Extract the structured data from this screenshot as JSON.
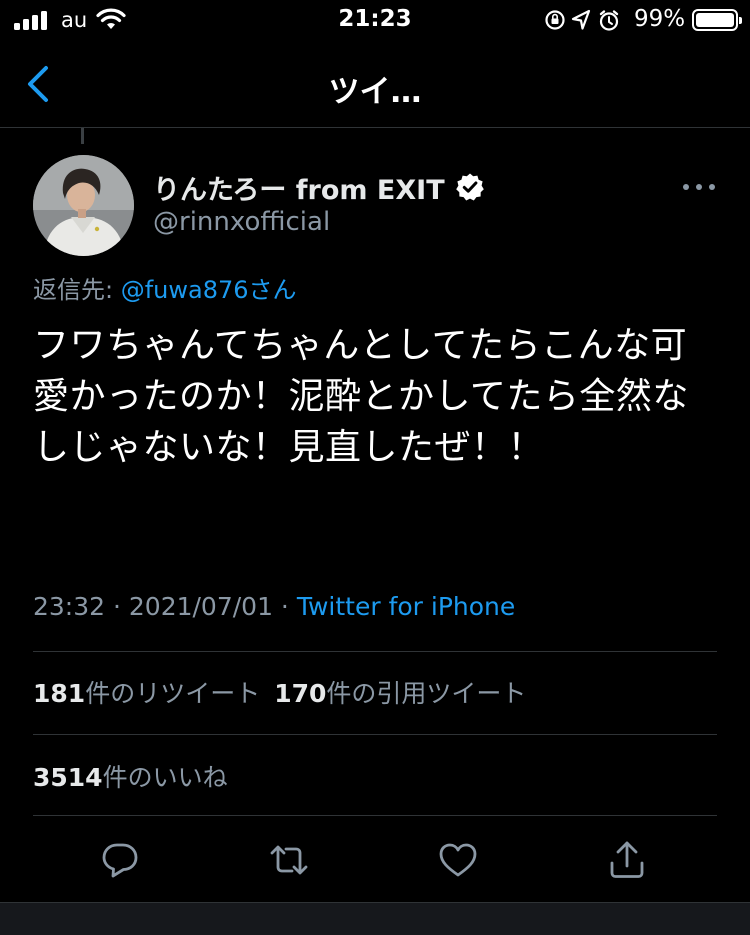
{
  "status_bar": {
    "carrier": "au",
    "time": "21:23",
    "battery_percent": "99%",
    "battery_level": 0.99
  },
  "nav": {
    "title": "ツイ…"
  },
  "tweet": {
    "display_name": "りんたろー from EXIT",
    "verified": true,
    "handle": "@rinnxofficial",
    "reply_prefix": "返信先: ",
    "reply_mention": "@fuwa876さん",
    "text": "フワちゃんてちゃんとしてたらこんな可愛かったのか！泥酔とかしてたら全然なしじゃないな！見直したぜ！！",
    "timestamp": "23:32 · 2021/07/01 · ",
    "source": "Twitter for iPhone"
  },
  "stats": {
    "retweets_count": "181",
    "retweets_label": "件のリツイート",
    "quotes_count": "170",
    "quotes_label": "件の引用ツイート",
    "likes_count": "3514",
    "likes_label": "件のいいね"
  },
  "icons": {
    "reply": "reply-icon",
    "retweet": "retweet-icon",
    "like": "heart-icon",
    "share": "share-icon"
  },
  "colors": {
    "background": "#000000",
    "accent": "#1d9bf0",
    "secondary_text": "#8b98a5",
    "divider": "#2f3336"
  }
}
